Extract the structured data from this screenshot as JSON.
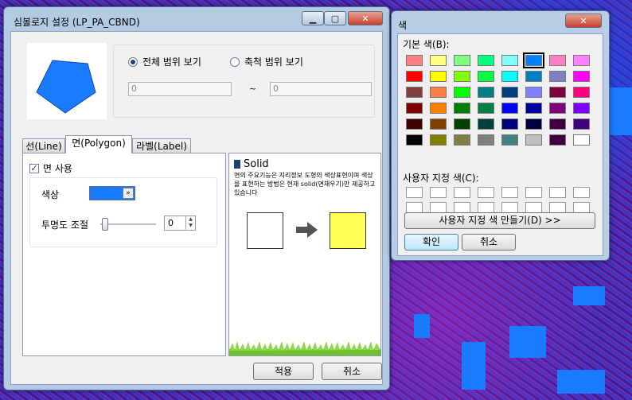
{
  "symbol_dialog": {
    "title": "심볼로지 설정 (LP_PA_CBND)",
    "scale": {
      "option_all": "전체 범위 보기",
      "option_scale": "축척 범위 보기",
      "min_value": "0",
      "separator": "~",
      "max_value": "0"
    },
    "tabs": [
      "선(Line)",
      "면(Polygon)",
      "라벨(Label)"
    ],
    "polygon": {
      "use_label": "면 사용",
      "use_checked": true,
      "color_label": "색상",
      "color_value": "#1a7bff",
      "opacity_label": "투명도 조절",
      "opacity_value": "0"
    },
    "info": {
      "heading": "Solid",
      "description": "면의 주요기능은 지리정보 도형의 색상표현이며 색상을 표현하는 방법은 현재 solid(면채우기)만 제공하고 있습니다"
    },
    "buttons": {
      "apply": "적용",
      "cancel": "취소"
    }
  },
  "color_dialog": {
    "title": "색",
    "basic_label": "기본 색(B):",
    "basic_colors": [
      [
        "#ff8080",
        "#ffff80",
        "#80ff80",
        "#00ff80",
        "#80ffff",
        "#0080ff",
        "#ff80c0",
        "#ff80ff"
      ],
      [
        "#ff0000",
        "#ffff00",
        "#80ff00",
        "#00ff40",
        "#00ffff",
        "#0080c0",
        "#8080c0",
        "#ff00ff"
      ],
      [
        "#804040",
        "#ff8040",
        "#00ff00",
        "#008080",
        "#004080",
        "#8080ff",
        "#800040",
        "#ff0080"
      ],
      [
        "#800000",
        "#ff8000",
        "#008000",
        "#008040",
        "#0000ff",
        "#0000a0",
        "#800080",
        "#8000ff"
      ],
      [
        "#400000",
        "#804000",
        "#004000",
        "#004040",
        "#000080",
        "#000040",
        "#400040",
        "#400080"
      ],
      [
        "#000000",
        "#808000",
        "#808040",
        "#808080",
        "#408080",
        "#c0c0c0",
        "#400040",
        "#ffffff"
      ]
    ],
    "selected": [
      0,
      5
    ],
    "custom_label": "사용자 지정 색(C):",
    "define_button": "사용자 지정 색 만들기(D) >>",
    "ok": "확인",
    "cancel": "취소"
  }
}
